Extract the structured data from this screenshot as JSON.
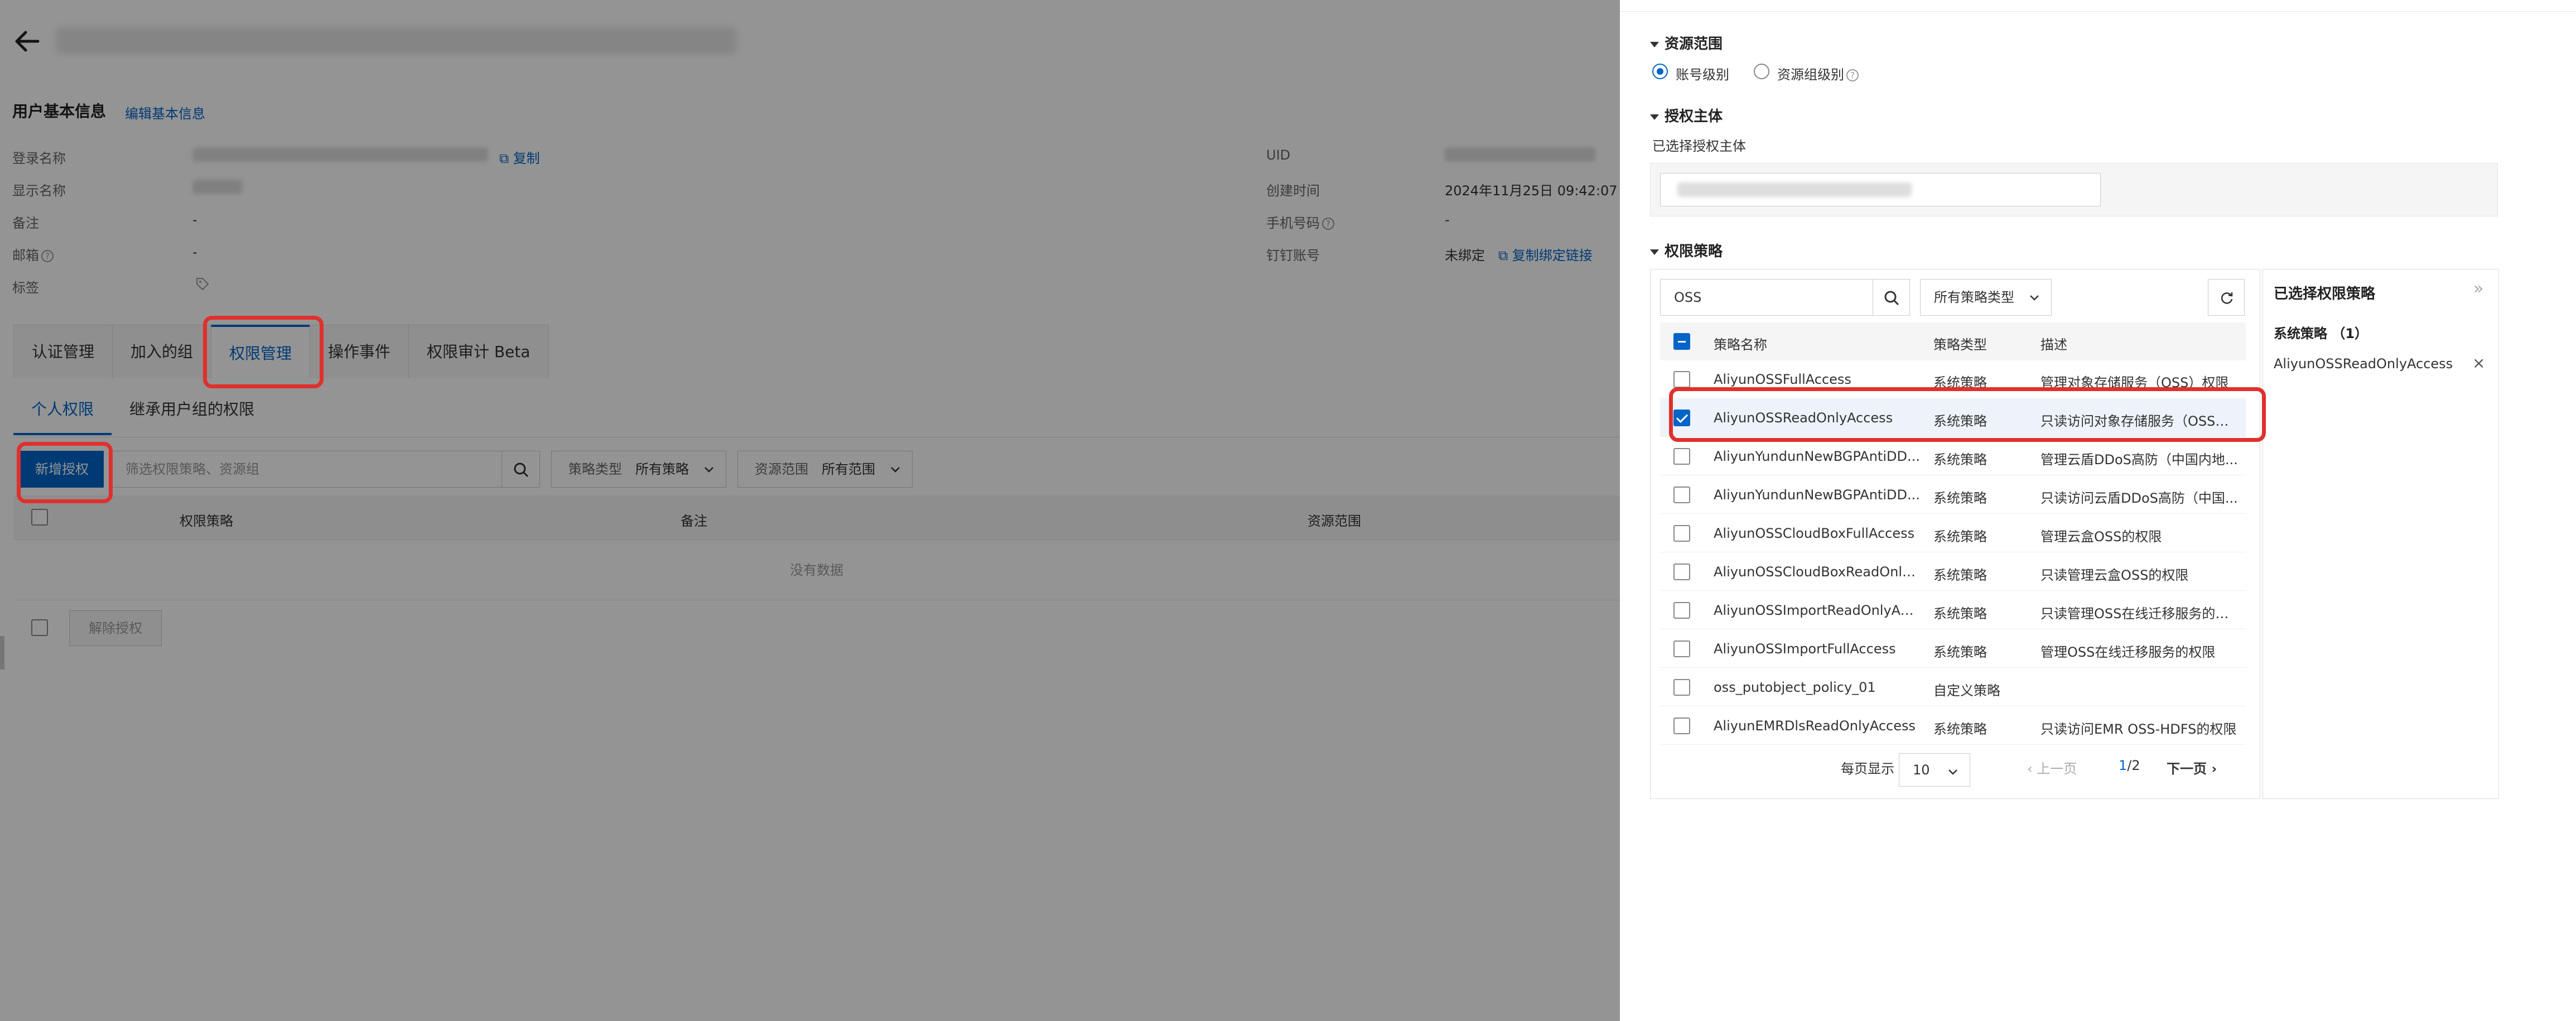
{
  "left": {
    "user_info_title": "用户基本信息",
    "edit_link": "编辑基本信息",
    "fields_left": [
      {
        "label": "登录名称",
        "action": "复制"
      },
      {
        "label": "显示名称"
      },
      {
        "label": "备注",
        "value": "-"
      },
      {
        "label": "邮箱",
        "value": "-"
      },
      {
        "label": "标签"
      }
    ],
    "fields_right": [
      {
        "label": "UID"
      },
      {
        "label": "创建时间",
        "value": "2024年11月25日 09:42:07"
      },
      {
        "label": "手机号码",
        "value": "-"
      },
      {
        "label": "钉钉账号",
        "value": "未绑定",
        "action": "复制绑定链接"
      }
    ],
    "tabs": [
      "认证管理",
      "加入的组",
      "权限管理",
      "操作事件",
      "权限审计 Beta"
    ],
    "active_tab": "权限管理",
    "subtabs": [
      "个人权限",
      "继承用户组的权限"
    ],
    "add_button": "新增授权",
    "filter_placeholder": "筛选权限策略、资源组",
    "policy_type_label": "策略类型",
    "policy_type_value": "所有策略",
    "scope_label": "资源范围",
    "scope_value": "所有范围",
    "table_headers": [
      "权限策略",
      "备注",
      "资源范围"
    ],
    "empty_text": "没有数据",
    "revoke_button": "解除授权"
  },
  "right": {
    "resource_scope_title": "资源范围",
    "scope_options": [
      "账号级别",
      "资源组级别"
    ],
    "scope_selected": "账号级别",
    "principal_title": "授权主体",
    "principal_selected_label": "已选择授权主体",
    "policy_title": "权限策略",
    "search_value": "OSS",
    "type_select": "所有策略类型",
    "table_headers": [
      "策略名称",
      "策略类型",
      "描述"
    ],
    "rows": [
      {
        "name": "AliyunOSSFullAccess",
        "type": "系统策略",
        "desc": "管理对象存储服务（OSS）权限",
        "checked": false
      },
      {
        "name": "AliyunOSSReadOnlyAccess",
        "type": "系统策略",
        "desc": "只读访问对象存储服务（OSS）...",
        "checked": true
      },
      {
        "name": "AliyunYundunNewBGPAntiDD...",
        "type": "系统策略",
        "desc": "管理云盾DDoS高防（中国内地...",
        "checked": false
      },
      {
        "name": "AliyunYundunNewBGPAntiDD...",
        "type": "系统策略",
        "desc": "只读访问云盾DDoS高防（中国...",
        "checked": false
      },
      {
        "name": "AliyunOSSCloudBoxFullAccess",
        "type": "系统策略",
        "desc": "管理云盒OSS的权限",
        "checked": false
      },
      {
        "name": "AliyunOSSCloudBoxReadOnly...",
        "type": "系统策略",
        "desc": "只读管理云盒OSS的权限",
        "checked": false
      },
      {
        "name": "AliyunOSSImportReadOnlyAc...",
        "type": "系统策略",
        "desc": "只读管理OSS在线迁移服务的权...",
        "checked": false
      },
      {
        "name": "AliyunOSSImportFullAccess",
        "type": "系统策略",
        "desc": "管理OSS在线迁移服务的权限",
        "checked": false
      },
      {
        "name": "oss_putobject_policy_01",
        "type": "自定义策略",
        "desc": "",
        "checked": false
      },
      {
        "name": "AliyunEMRDlsReadOnlyAccess",
        "type": "系统策略",
        "desc": "只读访问EMR OSS-HDFS的权限",
        "checked": false
      }
    ],
    "pager": {
      "per_page_label": "每页显示",
      "per_page_value": "10",
      "prev": "上一页",
      "current": "1",
      "total": "/2",
      "next": "下一页"
    },
    "selected_panel": {
      "title": "已选择权限策略",
      "group": "系统策略 （1）",
      "items": [
        "AliyunOSSReadOnlyAccess"
      ]
    }
  },
  "colors": {
    "accent": "#0064c8",
    "highlight": "#e0302d"
  }
}
